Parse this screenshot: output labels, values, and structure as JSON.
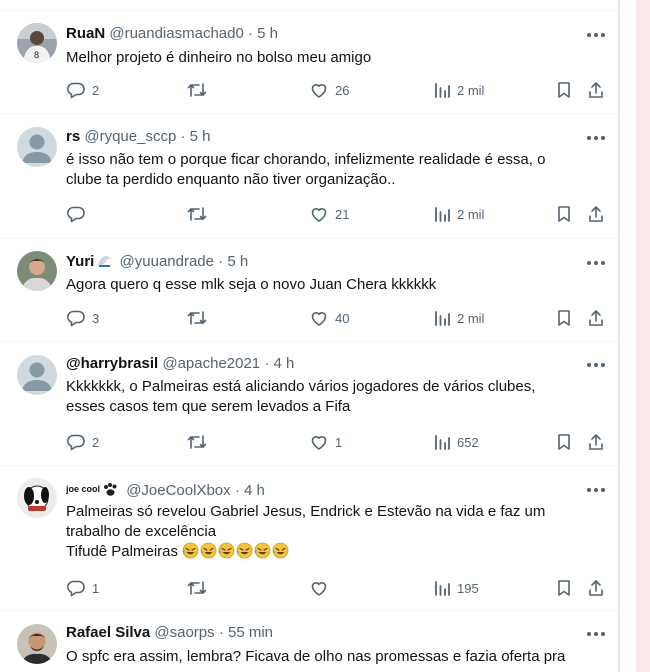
{
  "tweets": [
    {
      "name": "RuaN",
      "handle": "@ruandiasmachad0",
      "time": "5 h",
      "lines": [
        "Melhor projeto é dinheiro no bolso meu amigo"
      ],
      "replies": "2",
      "reposts": "",
      "likes": "26",
      "views": "2 mil"
    },
    {
      "name": "rs",
      "handle": "@ryque_sccp",
      "time": "5 h",
      "lines": [
        "é isso não tem o porque ficar chorando, infelizmente realidade é essa, o",
        "clube ta perdido enquanto não tiver organização.."
      ],
      "replies": "",
      "reposts": "",
      "likes": "21",
      "views": "2 mil"
    },
    {
      "name": "Yuri",
      "name_badge": "bird-emoji",
      "handle": "@yuuandrade",
      "time": "5 h",
      "lines": [
        "Agora quero q esse mlk seja o novo Juan Chera kkkkkk"
      ],
      "replies": "3",
      "reposts": "",
      "likes": "40",
      "views": "2 mil"
    },
    {
      "name": "@harrybrasil",
      "handle": "@apache2021",
      "time": "4 h",
      "lines": [
        "Kkkkkkk, o Palmeiras está aliciando vários jogadores de vários clubes,",
        "esses casos tem que serem levados a Fifa"
      ],
      "replies": "2",
      "reposts": "",
      "likes": "1",
      "views": "652"
    },
    {
      "name": "joe cool",
      "name_badge": "paw-emoji",
      "handle": "@JoeCoolXbox",
      "time": "4 h",
      "lines": [
        "Palmeiras só revelou Gabriel Jesus, Endrick e Estevão na vida e faz um",
        "trabalho de excelência",
        "Tifudê Palmeiras"
      ],
      "emoji_line_suffix": "rolling-on-floor-laughing-emoji x6",
      "replies": "1",
      "reposts": "",
      "likes": "",
      "views": "195"
    },
    {
      "name": "Rafael Silva",
      "handle": "@saorps",
      "time": "55 min",
      "lines": [
        "O spfc era assim, lembra? Ficava de olho nas promessas e fazia oferta pra"
      ]
    }
  ],
  "separator": "·",
  "colors": {
    "text": "#0f1419",
    "muted": "#536471",
    "divider": "#eff3f4",
    "face": "#f7c33b"
  }
}
